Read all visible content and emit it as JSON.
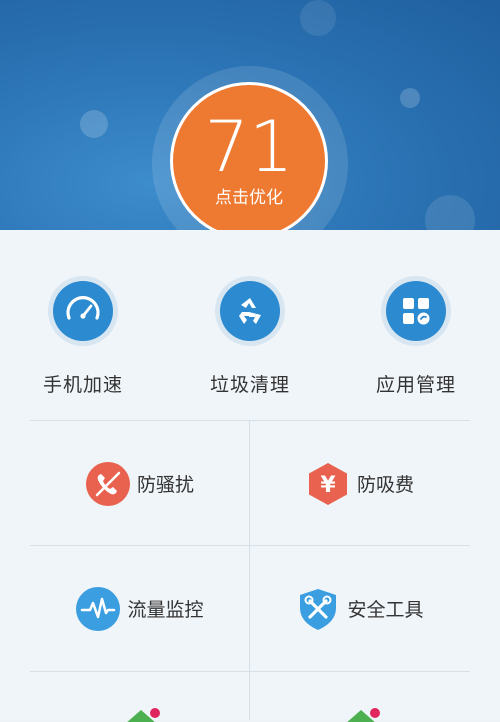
{
  "score": {
    "value": "71",
    "action_label": "点击优化"
  },
  "quick_actions": [
    {
      "label": "手机加速",
      "icon": "speedometer-icon"
    },
    {
      "label": "垃圾清理",
      "icon": "recycle-icon"
    },
    {
      "label": "应用管理",
      "icon": "app-grid-icon"
    }
  ],
  "tools": [
    {
      "label": "防骚扰",
      "icon": "blocked-phone-icon",
      "color": "#e9624f"
    },
    {
      "label": "防吸费",
      "icon": "yuan-hexagon-icon",
      "color": "#e9624f"
    },
    {
      "label": "流量监控",
      "icon": "pulse-icon",
      "color": "#3a9ee0"
    },
    {
      "label": "安全工具",
      "icon": "wrench-shield-icon",
      "color": "#3a9ee0"
    }
  ],
  "colors": {
    "hero_blue": "#2c75b6",
    "score_orange": "#ee7a32",
    "accent_blue": "#2b8ad0",
    "accent_red": "#e9624f"
  }
}
